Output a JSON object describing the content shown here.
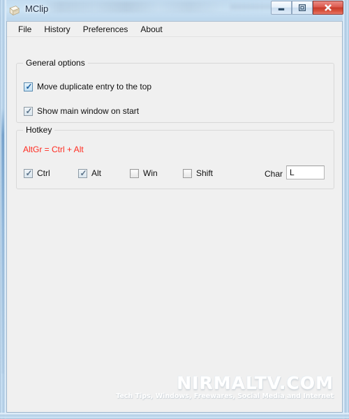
{
  "window": {
    "title": "MClip",
    "icon": "clipboard-notepad-icon",
    "controls": {
      "minimize_label": "Minimize",
      "maximize_label": "Restore",
      "close_label": "Close"
    }
  },
  "menubar": {
    "items": [
      {
        "label": "File"
      },
      {
        "label": "History"
      },
      {
        "label": "Preferences"
      },
      {
        "label": "About"
      }
    ]
  },
  "general_options": {
    "title": "General options",
    "checkboxes": [
      {
        "label": "Move duplicate entry to the top",
        "checked": true
      },
      {
        "label": "Show main window on start",
        "checked": true
      }
    ]
  },
  "hotkey": {
    "title": "Hotkey",
    "note": "AltGr = Ctrl + Alt",
    "note_color": "#ff2b20",
    "modifiers": [
      {
        "label": "Ctrl",
        "checked": true
      },
      {
        "label": "Alt",
        "checked": true
      },
      {
        "label": "Win",
        "checked": false
      },
      {
        "label": "Shift",
        "checked": false
      }
    ],
    "char_label": "Char",
    "char_value": "L",
    "char_placeholder": ""
  },
  "watermark": {
    "main": "NIRMALTV.COM",
    "tagline": "Tech Tips, Windows, Freewares, Social Media and Internet"
  }
}
